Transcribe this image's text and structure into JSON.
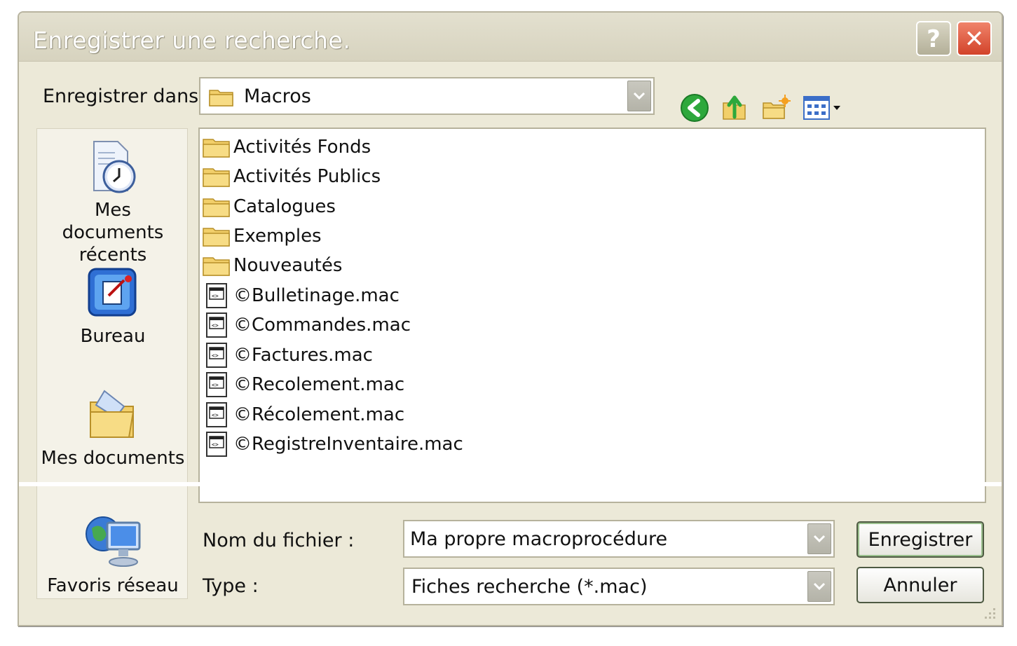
{
  "window": {
    "title": "Enregistrer une recherche.",
    "help_label": "?",
    "close_label": "✕"
  },
  "location": {
    "label": "Enregistrer dans :",
    "value": "Macros"
  },
  "toolbar": {
    "icons": [
      "back-icon",
      "up-folder-icon",
      "new-folder-icon",
      "view-menu-icon"
    ]
  },
  "places": [
    {
      "label": "Mes documents récents",
      "icon": "recent-documents-icon"
    },
    {
      "label": "Bureau",
      "icon": "desktop-icon"
    },
    {
      "label": "Mes documents",
      "icon": "my-documents-icon"
    },
    {
      "label": "Favoris réseau",
      "icon": "network-places-icon"
    }
  ],
  "files": [
    {
      "name": "Activités Fonds",
      "type": "folder"
    },
    {
      "name": "Activités Publics",
      "type": "folder"
    },
    {
      "name": "Catalogues",
      "type": "folder"
    },
    {
      "name": "Exemples",
      "type": "folder"
    },
    {
      "name": "Nouveautés",
      "type": "folder"
    },
    {
      "name": "©Bulletinage.mac",
      "type": "file"
    },
    {
      "name": "©Commandes.mac",
      "type": "file"
    },
    {
      "name": "©Factures.mac",
      "type": "file"
    },
    {
      "name": "©Recolement.mac",
      "type": "file"
    },
    {
      "name": "©Récolement.mac",
      "type": "file"
    },
    {
      "name": "©RegistreInventaire.mac",
      "type": "file"
    }
  ],
  "filename": {
    "label": "Nom du fichier :",
    "value": "Ma propre macroprocédure"
  },
  "filetype": {
    "label": "Type :",
    "value": "Fiches recherche (*.mac)"
  },
  "buttons": {
    "save": "Enregistrer",
    "cancel": "Annuler"
  },
  "colors": {
    "dialog_bg": "#ece9d8",
    "folder": "#f2cf6a",
    "back_arrow": "#2ea83c",
    "close_button": "#d2432a"
  }
}
